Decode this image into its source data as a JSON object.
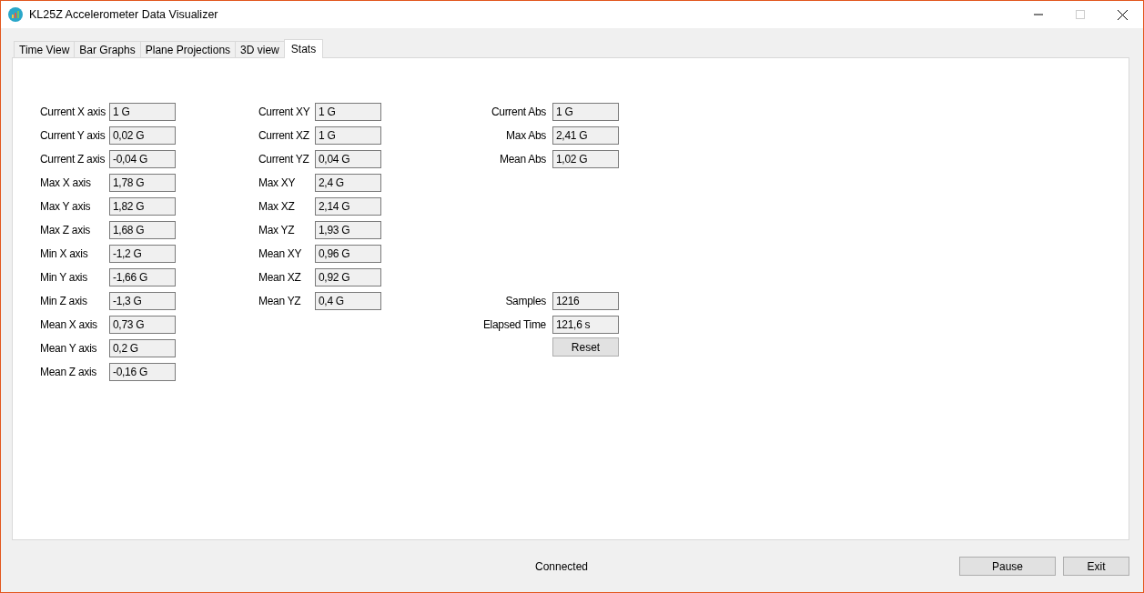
{
  "window": {
    "title": "KL25Z Accelerometer Data Visualizer"
  },
  "tabs": [
    {
      "label": "Time View",
      "selected": false
    },
    {
      "label": "Bar Graphs",
      "selected": false
    },
    {
      "label": "Plane Projections",
      "selected": false
    },
    {
      "label": "3D view",
      "selected": false
    },
    {
      "label": "Stats",
      "selected": true
    }
  ],
  "axis_stats": [
    {
      "label": "Current X axis",
      "value": "1 G"
    },
    {
      "label": "Current Y axis",
      "value": "0,02 G"
    },
    {
      "label": "Current Z axis",
      "value": "-0,04 G"
    },
    {
      "label": "Max X axis",
      "value": "1,78 G"
    },
    {
      "label": "Max Y axis",
      "value": "1,82 G"
    },
    {
      "label": "Max Z axis",
      "value": "1,68 G"
    },
    {
      "label": "Min X axis",
      "value": "-1,2 G"
    },
    {
      "label": "Min Y axis",
      "value": "-1,66 G"
    },
    {
      "label": "Min Z axis",
      "value": "-1,3 G"
    },
    {
      "label": "Mean X axis",
      "value": "0,73 G"
    },
    {
      "label": "Mean Y axis",
      "value": "0,2 G"
    },
    {
      "label": "Mean Z axis",
      "value": "-0,16 G"
    }
  ],
  "plane_stats": [
    {
      "label": "Current XY",
      "value": "1 G"
    },
    {
      "label": "Current XZ",
      "value": "1 G"
    },
    {
      "label": "Current YZ",
      "value": "0,04 G"
    },
    {
      "label": "Max XY",
      "value": "2,4 G"
    },
    {
      "label": "Max XZ",
      "value": "2,14 G"
    },
    {
      "label": "Max YZ",
      "value": "1,93 G"
    },
    {
      "label": "Mean XY",
      "value": "0,96 G"
    },
    {
      "label": "Mean XZ",
      "value": "0,92 G"
    },
    {
      "label": "Mean YZ",
      "value": "0,4 G"
    }
  ],
  "abs_stats": [
    {
      "label": "Current Abs",
      "value": "1 G"
    },
    {
      "label": "Max Abs",
      "value": "2,41 G"
    },
    {
      "label": "Mean Abs",
      "value": "1,02 G"
    }
  ],
  "timing": [
    {
      "label": "Samples",
      "value": "1216"
    },
    {
      "label": "Elapsed Time",
      "value": "121,6 s"
    }
  ],
  "reset_button": "Reset",
  "status": "Connected",
  "buttons": [
    "Pause",
    "Exit"
  ]
}
